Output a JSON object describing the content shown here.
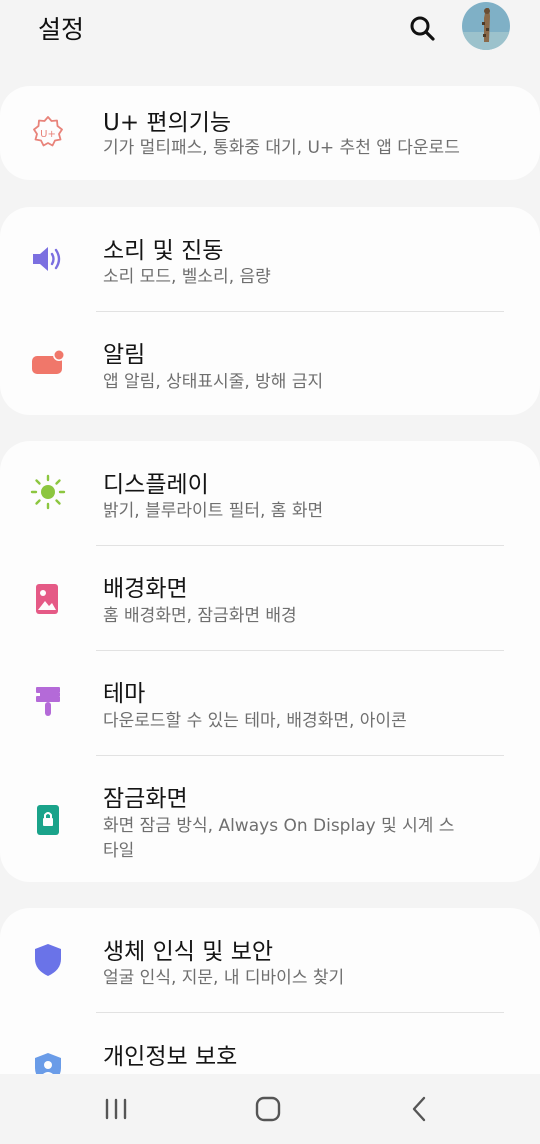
{
  "header": {
    "title": "설정"
  },
  "cards": [
    {
      "items": [
        {
          "label": "U+ 편의기능",
          "sub": "기가 멀티패스, 통화중 대기, U+ 추천 앱 다운로드"
        }
      ]
    },
    {
      "items": [
        {
          "label": "소리 및 진동",
          "sub": "소리 모드, 벨소리, 음량"
        },
        {
          "label": "알림",
          "sub": "앱 알림, 상태표시줄, 방해 금지"
        }
      ]
    },
    {
      "items": [
        {
          "label": "디스플레이",
          "sub": "밝기, 블루라이트 필터, 홈 화면"
        },
        {
          "label": "배경화면",
          "sub": "홈 배경화면, 잠금화면 배경"
        },
        {
          "label": "테마",
          "sub": "다운로드할 수 있는 테마, 배경화면, 아이콘"
        },
        {
          "label": "잠금화면",
          "sub": "화면 잠금 방식, Always On Display 및 시계 스타일"
        }
      ]
    },
    {
      "items": [
        {
          "label": "생체 인식 및 보안",
          "sub": "얼굴 인식, 지문, 내 디바이스 찾기"
        },
        {
          "label": "개인정보 보호"
        }
      ]
    }
  ],
  "colors": {
    "uplus": "#e8837a",
    "sound": "#7b6fe0",
    "notif": "#f0776a",
    "display": "#8cc63f",
    "wallpaper": "#e55a86",
    "theme": "#b46ad8",
    "lock": "#1aa38a",
    "security": "#6a73e8",
    "privacy": "#6a9ce8"
  },
  "icons": {
    "uplus": "gear-uplus-icon",
    "sound": "speaker-icon",
    "notif": "notification-icon",
    "display": "sun-icon",
    "wallpaper": "image-icon",
    "theme": "paintbrush-icon",
    "lock": "lock-icon",
    "security": "shield-icon",
    "privacy": "privacy-shield-icon"
  }
}
